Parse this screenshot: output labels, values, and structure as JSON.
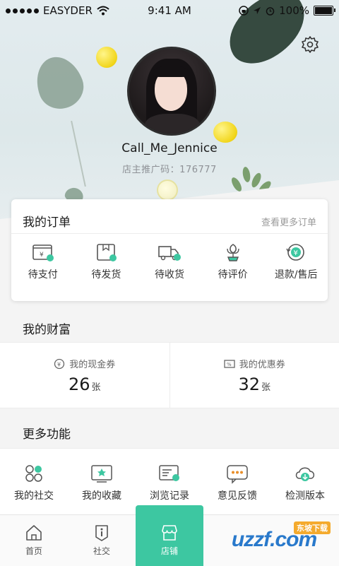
{
  "status_bar": {
    "carrier": "EASYDER",
    "time": "9:41 AM",
    "battery": "100%"
  },
  "profile": {
    "username": "Call_Me_Jennice",
    "promo_code": "店主推广码：176777"
  },
  "orders": {
    "title": "我的订单",
    "more_link": "查看更多订单",
    "items": [
      {
        "label": "待支付",
        "icon": "wallet-icon"
      },
      {
        "label": "待发货",
        "icon": "package-icon"
      },
      {
        "label": "待收货",
        "icon": "truck-icon"
      },
      {
        "label": "待评价",
        "icon": "flower-icon"
      },
      {
        "label": "退款/售后",
        "icon": "refund-icon"
      }
    ]
  },
  "wealth": {
    "title": "我的财富",
    "cash": {
      "label": "我的现金券",
      "count": "26",
      "unit": "张"
    },
    "coupon": {
      "label": "我的优惠券",
      "count": "32",
      "unit": "张"
    }
  },
  "more_functions": {
    "title": "更多功能",
    "items": [
      {
        "label": "我的社交",
        "icon": "social-icon"
      },
      {
        "label": "我的收藏",
        "icon": "favorites-icon"
      },
      {
        "label": "浏览记录",
        "icon": "history-icon"
      },
      {
        "label": "意见反馈",
        "icon": "feedback-icon"
      },
      {
        "label": "检测版本",
        "icon": "update-icon"
      }
    ]
  },
  "tabbar": {
    "items": [
      {
        "label": "首页",
        "icon": "home-icon"
      },
      {
        "label": "社交",
        "icon": "info-icon"
      },
      {
        "label": "店铺",
        "icon": "shop-icon"
      }
    ],
    "active": "店铺"
  },
  "watermark": {
    "text": "uzzf.com",
    "tag": "东坡下载"
  },
  "colors": {
    "accent": "#3dc7a1",
    "text": "#1a1a1a",
    "muted": "#9a9a9a"
  }
}
